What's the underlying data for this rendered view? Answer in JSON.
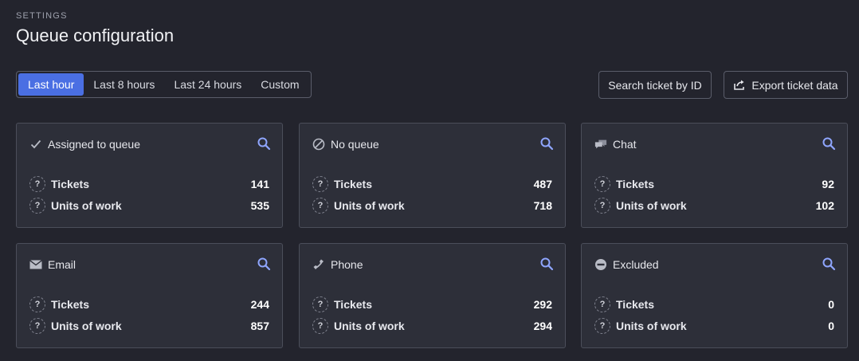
{
  "header": {
    "eyebrow": "SETTINGS",
    "title": "Queue configuration"
  },
  "time_range": {
    "options": [
      "Last hour",
      "Last 8 hours",
      "Last 24 hours",
      "Custom"
    ],
    "selected": "Last hour"
  },
  "actions": {
    "search_label": "Search ticket by ID",
    "export_label": "Export ticket data"
  },
  "colors": {
    "accent": "#4a6fe3",
    "search_icon": "#8fa6ff",
    "background": "#23242d",
    "card": "#2d2f39"
  },
  "metric_labels": {
    "tickets": "Tickets",
    "units": "Units of work"
  },
  "cards": [
    {
      "title": "Assigned to queue",
      "icon": "check-icon",
      "tickets": "141",
      "units": "535"
    },
    {
      "title": "No queue",
      "icon": "no-entry-icon",
      "tickets": "487",
      "units": "718"
    },
    {
      "title": "Chat",
      "icon": "chat-icon",
      "tickets": "92",
      "units": "102"
    },
    {
      "title": "Email",
      "icon": "envelope-icon",
      "tickets": "244",
      "units": "857"
    },
    {
      "title": "Phone",
      "icon": "phone-icon",
      "tickets": "292",
      "units": "294"
    },
    {
      "title": "Excluded",
      "icon": "minus-circle-icon",
      "tickets": "0",
      "units": "0"
    }
  ]
}
